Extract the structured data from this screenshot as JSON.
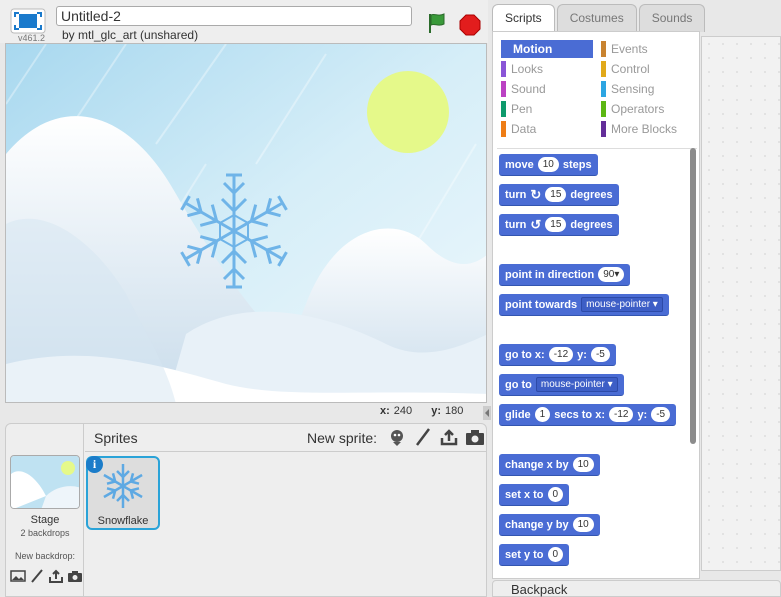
{
  "header": {
    "version": "v461.2",
    "project_title": "Untitled-2",
    "byline": "by mtl_glc_art (unshared)"
  },
  "stage": {
    "mouse_x_label": "x:",
    "mouse_x": "240",
    "mouse_y_label": "y:",
    "mouse_y": "180"
  },
  "sprites_pane": {
    "title": "Sprites",
    "new_sprite_label": "New sprite:",
    "stage_label": "Stage",
    "stage_backdrops": "2 backdrops",
    "new_backdrop_label": "New backdrop:",
    "sprites": [
      {
        "name": "Snowflake"
      }
    ]
  },
  "tabs": [
    {
      "label": "Scripts",
      "active": true
    },
    {
      "label": "Costumes",
      "active": false
    },
    {
      "label": "Sounds",
      "active": false
    }
  ],
  "categories": [
    {
      "label": "Motion",
      "color": "#4a6cd4",
      "active": true
    },
    {
      "label": "Looks",
      "color": "#8a55d7"
    },
    {
      "label": "Sound",
      "color": "#bb42c3"
    },
    {
      "label": "Pen",
      "color": "#0e9a6c"
    },
    {
      "label": "Data",
      "color": "#ee7d16"
    },
    {
      "label": "Events",
      "color": "#c88330"
    },
    {
      "label": "Control",
      "color": "#e1a91a"
    },
    {
      "label": "Sensing",
      "color": "#2ca5e2"
    },
    {
      "label": "Operators",
      "color": "#5cb712"
    },
    {
      "label": "More Blocks",
      "color": "#632d99"
    }
  ],
  "blocks": {
    "move": {
      "a": "move",
      "v": "10",
      "b": "steps"
    },
    "turn_right": {
      "a": "turn",
      "v": "15",
      "b": "degrees"
    },
    "turn_left": {
      "a": "turn",
      "v": "15",
      "b": "degrees"
    },
    "point_dir": {
      "a": "point in direction",
      "v": "90▾"
    },
    "point_towards": {
      "a": "point towards",
      "v": "mouse-pointer ▾"
    },
    "goto_xy": {
      "a": "go to x:",
      "x": "-12",
      "b": "y:",
      "y": "-5"
    },
    "goto": {
      "a": "go to",
      "v": "mouse-pointer ▾"
    },
    "glide": {
      "a": "glide",
      "s": "1",
      "b": "secs to x:",
      "x": "-12",
      "c": "y:",
      "y": "-5"
    },
    "change_x": {
      "a": "change x by",
      "v": "10"
    },
    "set_x": {
      "a": "set x to",
      "v": "0"
    },
    "change_y": {
      "a": "change y by",
      "v": "10"
    },
    "set_y": {
      "a": "set y to",
      "v": "0"
    }
  },
  "backpack_label": "Backpack",
  "icons": [
    "fullscreen-icon",
    "green-flag-icon",
    "stop-icon",
    "paint-icon",
    "upload-icon",
    "camera-icon",
    "library-icon",
    "info-icon"
  ]
}
